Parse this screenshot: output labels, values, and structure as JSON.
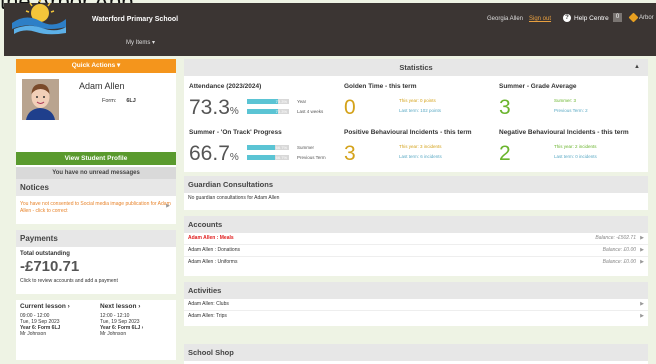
{
  "caption": "the Arbor App:",
  "topbar": {
    "school": "Waterford Primary School",
    "my_items": "My Items ▾",
    "user": "Georgia Allen",
    "sign_out": "Sign out",
    "help": "Help Centre",
    "count": "0",
    "app": "Arbor"
  },
  "sidebar": {
    "quick_actions": "Quick Actions ▾",
    "student_name": "Adam Allen",
    "form_label": "Form:",
    "form_value": "6LJ",
    "view_profile": "View Student Profile",
    "unread": "You have no unread messages",
    "notices_title": "Notices",
    "notice_text": "You have not consented to Social media image publication for Adam Allen - click to correct",
    "payments_title": "Payments",
    "total_label": "Total outstanding",
    "total_amount": "-£710.71",
    "payments_note": "Click to review accounts and add a payment",
    "current_title": "Current lesson ›",
    "current_time": "09:00 - 12:00",
    "current_date": "Tue, 19 Sep 2023",
    "current_class": "Year 6: Form 6LJ",
    "current_teacher": "Mr Johnson",
    "next_title": "Next lesson ›",
    "next_time": "12:00 - 12:10",
    "next_date": "Tue, 19 Sep 2023",
    "next_class": "Year 6: Form 6LJ ›",
    "next_teacher": "Mr Johnson"
  },
  "statistics": {
    "title": "Statistics",
    "attendance": {
      "title": "Attendance (2023/2024)",
      "value": "73.3",
      "unit": "%",
      "year_label": "Year",
      "year_bar": "73.3%",
      "year_level": 0.733,
      "weeks_label": "Last 4 weeks",
      "weeks_bar": "73.3%",
      "weeks_level": 0.733
    },
    "golden": {
      "title": "Golden Time - this term",
      "value": "0",
      "line1": "This year: 0 points",
      "line2": "Last term: 102 points"
    },
    "summer_grade": {
      "title": "Summer - Grade Average",
      "value": "3",
      "line1": "Summer: 3",
      "line2": "Previous Term: 2"
    },
    "ontrack": {
      "title": "Summer - 'On Track' Progress",
      "value": "66.7",
      "unit": "%",
      "summer_label": "Summer",
      "summer_bar": "66.7%",
      "summer_level": 0.667,
      "prev_label": "Previous Term",
      "prev_bar": "66.7%",
      "prev_level": 0.667
    },
    "positive": {
      "title": "Positive Behavioural Incidents - this term",
      "value": "3",
      "line1": "This year: 3 incidents",
      "line2": "Last term: 6 incidents"
    },
    "negative": {
      "title": "Negative Behavioural Incidents - this term",
      "value": "2",
      "line1": "This year: 2 incidents",
      "line2": "Last term: 0 incidents"
    }
  },
  "guardian": {
    "title": "Guardian Consultations",
    "text": "No guardian consultations for Adam Allen"
  },
  "accounts": {
    "title": "Accounts",
    "rows": [
      {
        "name": "Adam Allen : Meals",
        "balance": "Balance: -£502.71"
      },
      {
        "name": "Adam Allen : Donations",
        "balance": "Balance: £0.00"
      },
      {
        "name": "Adam Allen : Uniforms",
        "balance": "Balance: £0.00"
      }
    ]
  },
  "activities": {
    "title": "Activities",
    "rows": [
      "Adam Allen: Clubs",
      "Adam Allen: Trips"
    ]
  },
  "shop": {
    "title": "School Shop"
  },
  "colors": {
    "accent": "#f4951c",
    "green": "#6ab42d",
    "button_green": "#5a9a2e",
    "yellow": "#d4a21a",
    "teal": "#5bc4d4",
    "alert": "#e02020",
    "topbar": "#3b3533"
  }
}
